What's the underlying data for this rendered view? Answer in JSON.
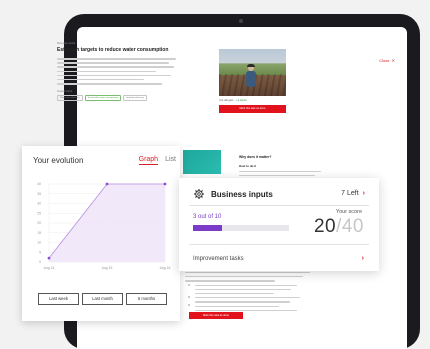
{
  "tablet": {
    "close_label": "Close",
    "close_icon": "close-icon",
    "eyebrow": "Business inputs",
    "goal_title": "Establish targets to reduce water consumption",
    "sub_eyebrow": "Related topics",
    "chips": [
      "Water use efficiency",
      "Sustainable water management",
      "Irrigation planning"
    ],
    "you_will_gain": "You will gain",
    "points": "+1 points",
    "primary_button": "Mark this task as done",
    "why_title": "Why does it matter?",
    "how_title": "How to do it",
    "bottom_button": "Mark this task as done"
  },
  "evolution": {
    "title": "Your evolution",
    "tab_graph": "Graph",
    "tab_list": "List",
    "ranges": [
      "Last week",
      "Last month",
      "6 months"
    ]
  },
  "business": {
    "title": "Business inputs",
    "left_text": "7 Left",
    "progress_text": "3 out of 10",
    "progress_fraction": 0.3,
    "score_label": "Your score",
    "score_value": "20",
    "score_denom": "/40",
    "improvement_label": "Improvement tasks"
  },
  "chart_data": {
    "type": "area",
    "title": "",
    "xlabel": "",
    "ylabel": "",
    "x": [
      "Aug 14",
      "Aug 15",
      "Aug 16"
    ],
    "series": [
      {
        "values": [
          2,
          40,
          40
        ]
      }
    ],
    "y_ticks": [
      "0",
      "5",
      "10",
      "15",
      "20",
      "25",
      "30",
      "35",
      "40"
    ],
    "ylim": [
      0,
      40
    ],
    "grid": true,
    "colors": {
      "line": "#b48de0",
      "fill": "#efe6fa",
      "point": "#8a4fd6"
    }
  },
  "colors": {
    "accent_red": "#d9202a",
    "progress_purple": "#7a3cc9"
  }
}
